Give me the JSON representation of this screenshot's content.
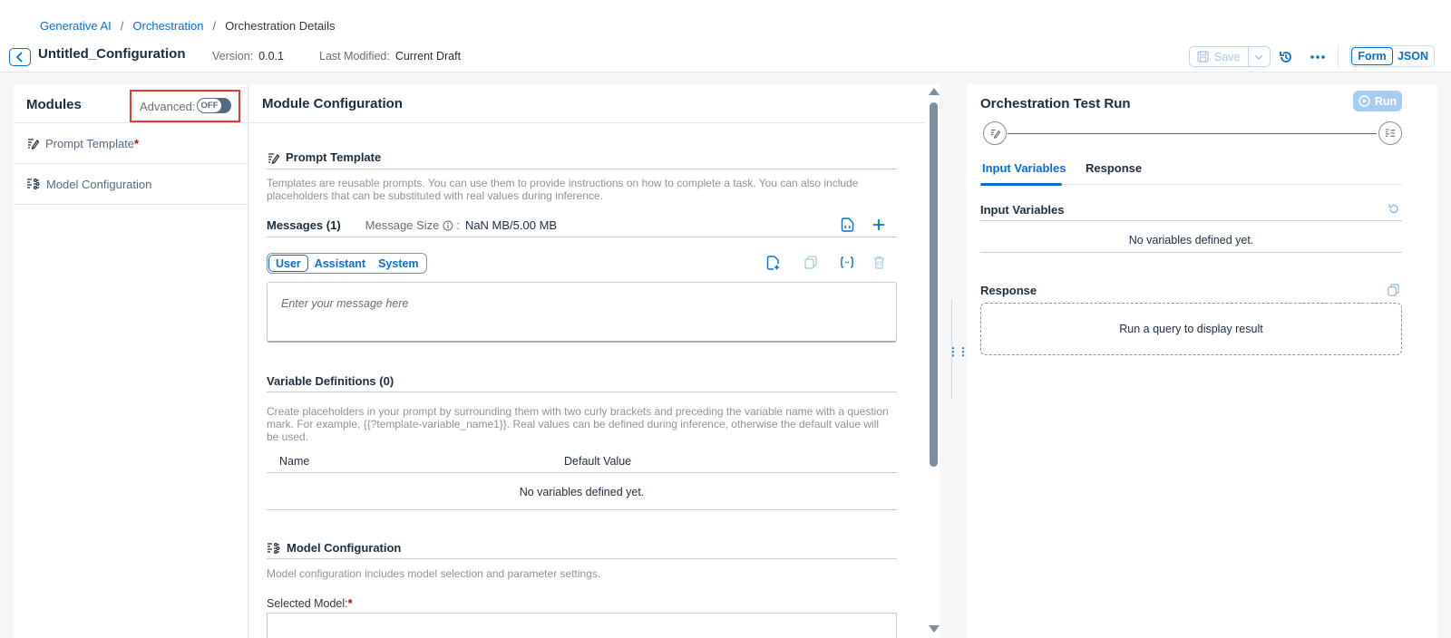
{
  "breadcrumb": {
    "items": [
      "Generative AI",
      "Orchestration",
      "Orchestration Details"
    ],
    "separator": "/"
  },
  "header": {
    "title": "Untitled_Configuration",
    "version_label": "Version:",
    "version_value": "0.0.1",
    "modified_label": "Last Modified:",
    "modified_value": "Current Draft",
    "save_label": "Save",
    "mode_form": "Form",
    "mode_json": "JSON"
  },
  "modules": {
    "title": "Modules",
    "advanced_label": "Advanced:",
    "advanced_state": "OFF",
    "items": [
      {
        "label": "Prompt Template",
        "required": "*",
        "icon": "prompt-template-icon"
      },
      {
        "label": "Model Configuration",
        "required": "",
        "icon": "model-configuration-icon"
      }
    ]
  },
  "config": {
    "title": "Module Configuration",
    "prompt": {
      "title": "Prompt Template",
      "description": "Templates are reusable prompts. You can use them to provide instructions on how to complete a task. You can also include placeholders that can be substituted with real values during inference.",
      "messages_title": "Messages (1)",
      "message_size_label": "Message Size",
      "message_size_sep": ":",
      "message_size_value": "NaN MB/5.00 MB",
      "roles": [
        "User",
        "Assistant",
        "System"
      ],
      "active_role": "User",
      "message_placeholder": "Enter your message here"
    },
    "variables": {
      "title": "Variable Definitions (0)",
      "description": "Create placeholders in your prompt by surrounding them with two curly brackets and preceding the variable name with a question mark. For example, {{?template-variable_name1}}. Real values can be defined during inference, otherwise the default value will be used.",
      "col_name": "Name",
      "col_default": "Default Value",
      "empty": "No variables defined yet."
    },
    "model": {
      "title": "Model Configuration",
      "description": "Model configuration includes model selection and parameter settings.",
      "selected_model_label": "Selected Model:",
      "required": "*"
    }
  },
  "test_run": {
    "title": "Orchestration Test Run",
    "run_label": "Run",
    "tabs": [
      "Input Variables",
      "Response"
    ],
    "active_tab": "Input Variables",
    "input_title": "Input Variables",
    "input_empty": "No variables defined yet.",
    "response_title": "Response",
    "response_placeholder": "Run a query to display result"
  },
  "colors": {
    "accent": "#0a6ed1",
    "highlight": "#e53935",
    "required": "#bb0000"
  }
}
